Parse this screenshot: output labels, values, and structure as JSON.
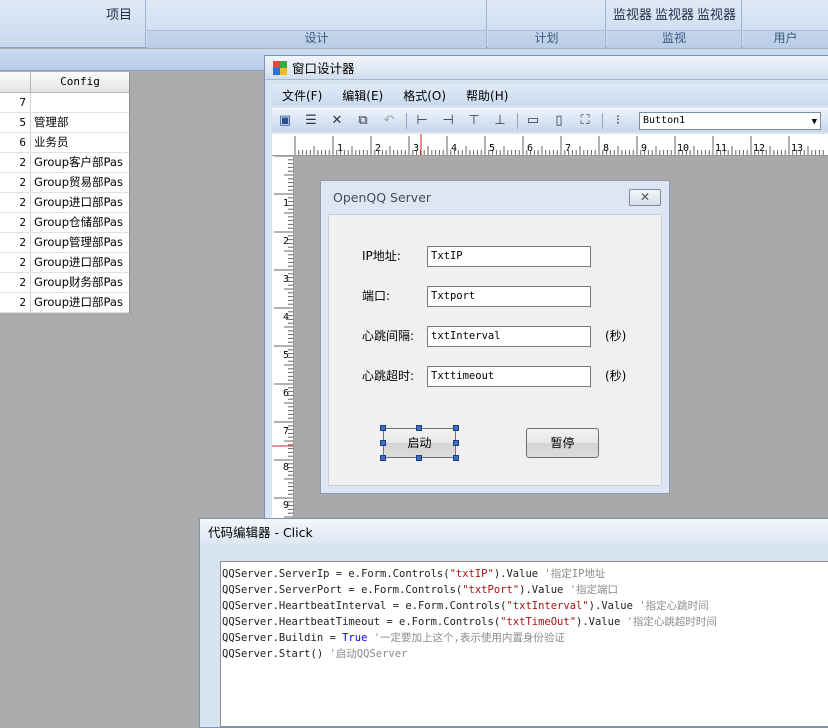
{
  "ribbon": {
    "group_labels": [
      "设计",
      "计划",
      "监视",
      "用户"
    ],
    "top_fragment": "项目",
    "monitors": [
      "监视器",
      "监视器",
      "监视器"
    ]
  },
  "grid": {
    "column_header": "Config",
    "rows": [
      {
        "n": "7",
        "v": ""
      },
      {
        "n": "5",
        "v": "管理部"
      },
      {
        "n": "6",
        "v": "业务员"
      },
      {
        "n": "2",
        "v": "Group客户部Pas"
      },
      {
        "n": "2",
        "v": "Group贸易部Pas"
      },
      {
        "n": "2",
        "v": "Group进口部Pas"
      },
      {
        "n": "2",
        "v": "Group仓储部Pas"
      },
      {
        "n": "2",
        "v": "Group管理部Pas"
      },
      {
        "n": "2",
        "v": "Group进口部Pas"
      },
      {
        "n": "2",
        "v": "Group财务部Pas"
      },
      {
        "n": "2",
        "v": "Group进口部Pas"
      }
    ]
  },
  "designer": {
    "title": "窗口设计器",
    "menu": [
      "文件(F)",
      "编辑(E)",
      "格式(O)",
      "帮助(H)"
    ],
    "combo_value": "Button1",
    "ruler_h": [
      "1",
      "2",
      "3",
      "4",
      "5",
      "6",
      "7",
      "8",
      "9",
      "10",
      "11",
      "12",
      "13"
    ],
    "ruler_v": [
      "1",
      "2",
      "3",
      "4",
      "5",
      "6",
      "7",
      "8",
      "9"
    ]
  },
  "form": {
    "title": "OpenQQ Server",
    "ip_label": "IP地址:",
    "ip_value": "TxtIP",
    "port_label": "端口:",
    "port_value": "Txtport",
    "interval_label": "心跳间隔:",
    "interval_value": "txtInterval",
    "interval_unit": "(秒)",
    "timeout_label": "心跳超时:",
    "timeout_value": "Txttimeout",
    "timeout_unit": "(秒)",
    "start_button": "启动",
    "pause_button": "暂停"
  },
  "code_editor": {
    "title": "代码编辑器 - Click",
    "lines": [
      {
        "a": "QQServer.ServerIp = e.Form.Controls(",
        "s": "\"txtIP\"",
        "b": ").Value ",
        "k": "",
        "c": "'指定IP地址"
      },
      {
        "a": "QQServer.ServerPort = e.Form.Controls(",
        "s": "\"txtPort\"",
        "b": ").Value ",
        "k": "",
        "c": "'指定端口"
      },
      {
        "a": "QQServer.HeartbeatInterval = e.Form.Controls(",
        "s": "\"txtInterval\"",
        "b": ").Value ",
        "k": "",
        "c": "'指定心跳时间"
      },
      {
        "a": "QQServer.HeartbeatTimeout = e.Form.Controls(",
        "s": "\"txtTimeOut\"",
        "b": ").Value ",
        "k": "",
        "c": "'指定心跳超时时间"
      },
      {
        "a": "QQServer.Buildin = ",
        "s": "",
        "b": "",
        "k": "True ",
        "c": "'一定要加上这个,表示使用内置身份验证"
      },
      {
        "a": "QQServer.Start() ",
        "s": "",
        "b": "",
        "k": "",
        "c": "'启动QQServer"
      }
    ]
  }
}
